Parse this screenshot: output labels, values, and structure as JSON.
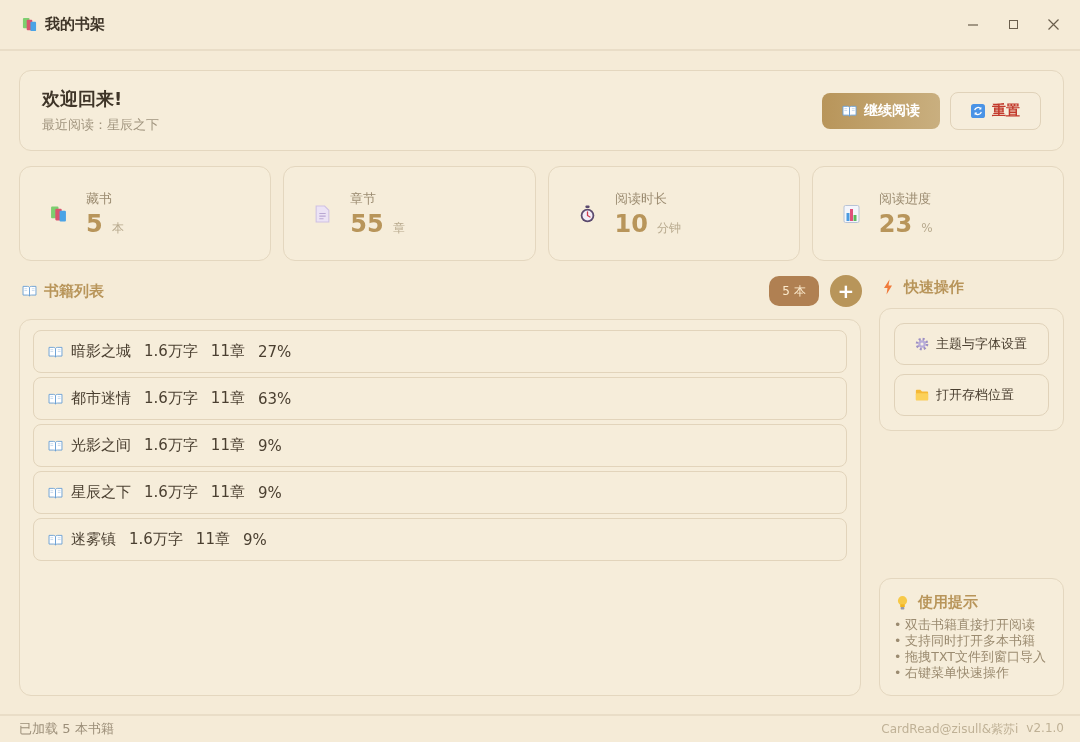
{
  "window": {
    "title": "我的书架"
  },
  "welcome": {
    "title": "欢迎回来!",
    "subtitle": "最近阅读：星辰之下",
    "buttons": [
      {
        "label": "继续阅读",
        "kind": "continue"
      },
      {
        "label": "重置",
        "kind": "reset"
      }
    ]
  },
  "stats": [
    {
      "label": "藏书",
      "value": "5",
      "unit": "本",
      "kind": "books"
    },
    {
      "label": "章节",
      "value": "55",
      "unit": "章",
      "kind": "chapters"
    },
    {
      "label": "阅读时长",
      "value": "10",
      "unit": "分钟",
      "kind": "duration"
    },
    {
      "label": "阅读进度",
      "value": "23",
      "unit": "%",
      "kind": "progress"
    }
  ],
  "book_list": {
    "title": "书籍列表",
    "count_badge": "5 本",
    "add_button": "+",
    "books": [
      {
        "name": "暗影之城",
        "words": "1.6万字",
        "chapters": "11章",
        "progress": "27%"
      },
      {
        "name": "都市迷情",
        "words": "1.6万字",
        "chapters": "11章",
        "progress": "63%"
      },
      {
        "name": "光影之间",
        "words": "1.6万字",
        "chapters": "11章",
        "progress": "9%"
      },
      {
        "name": "星辰之下",
        "words": "1.6万字",
        "chapters": "11章",
        "progress": "9%"
      },
      {
        "name": "迷雾镇",
        "words": "1.6万字",
        "chapters": "11章",
        "progress": "9%"
      }
    ]
  },
  "quick_actions": {
    "title": "快速操作",
    "actions": [
      {
        "label": "主题与字体设置",
        "kind": "theme"
      },
      {
        "label": "打开存档位置",
        "kind": "folder"
      }
    ]
  },
  "tips": {
    "title": "使用提示",
    "items": [
      "• 双击书籍直接打开阅读",
      "• 支持同时打开多本书籍",
      "• 拖拽TXT文件到窗口导入",
      "• 右键菜单快速操作"
    ]
  },
  "status_bar": {
    "left": "已加载 5 本书籍",
    "credit": "CardRead@zisull&紫苏i",
    "version": "v2.1.0"
  }
}
